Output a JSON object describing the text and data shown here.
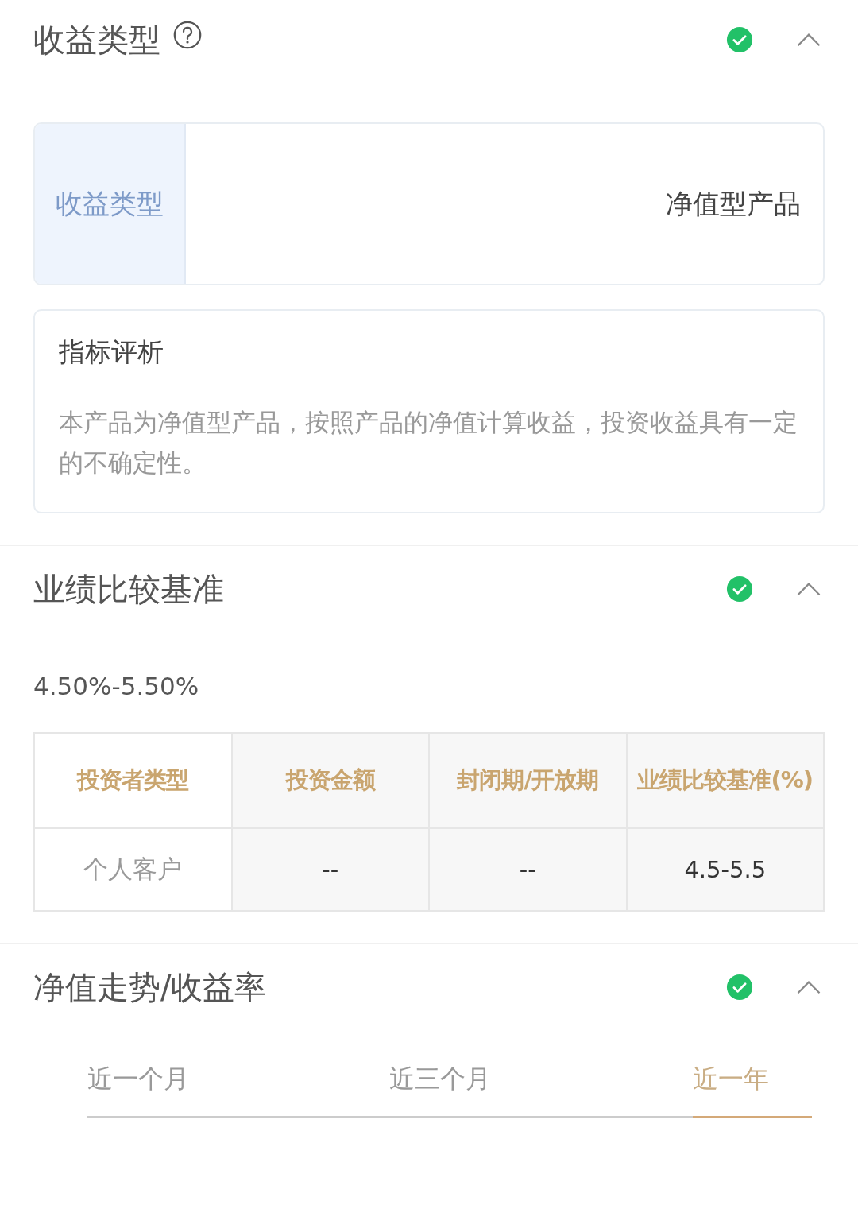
{
  "sections": [
    {
      "kind": "income_type",
      "title": "收益类型",
      "help": true,
      "complete": true,
      "expanded": true,
      "field": {
        "label": "收益类型",
        "value": "净值型产品"
      },
      "analysis": {
        "title": "指标评析",
        "text": "本产品为净值型产品，按照产品的净值计算收益，投资收益具有一定的不确定性。"
      }
    },
    {
      "kind": "benchmark",
      "title": "业绩比较基准",
      "help": false,
      "complete": true,
      "expanded": true,
      "value": "4.50%-5.50%",
      "table": {
        "columns": [
          "投资者类型",
          "投资金额",
          "封闭期/开放期",
          "业绩比较基准(%)"
        ],
        "rows": [
          [
            "个人客户",
            "--",
            "--",
            "4.5-5.5"
          ]
        ]
      }
    },
    {
      "kind": "trend",
      "title": "净值走势/收益率",
      "help": false,
      "complete": true,
      "expanded": true,
      "tabs": [
        {
          "label": "近一个月",
          "selected": false
        },
        {
          "label": "近三个月",
          "selected": false
        },
        {
          "label": "近一年",
          "selected": true
        }
      ]
    }
  ]
}
